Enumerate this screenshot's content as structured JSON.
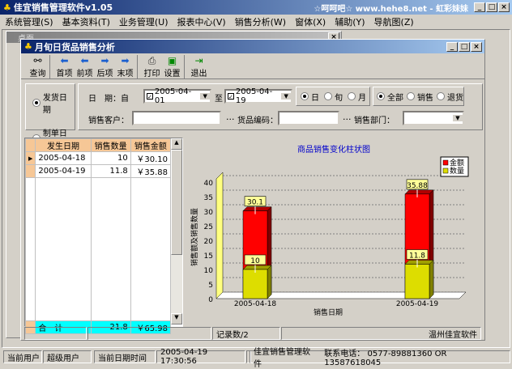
{
  "app": {
    "title": "佳宜销售管理软件v1.05",
    "right_title": "☆呵呵吧☆ www.hehe8.net - 虹彩妹妹"
  },
  "menu": [
    "系统管理(S)",
    "基本资料(T)",
    "业务管理(U)",
    "报表中心(V)",
    "销售分析(W)",
    "窗体(X)",
    "辅助(Y)",
    "导航图(Z)"
  ],
  "desktop_window": {
    "title": "桌面"
  },
  "window": {
    "title": "月旬日货品销售分析"
  },
  "toolbar": [
    {
      "label": "查询",
      "icon": "binoculars-icon"
    },
    {
      "label": "首项",
      "icon": "arrow-left-icon"
    },
    {
      "label": "前项",
      "icon": "arrow-left-icon"
    },
    {
      "label": "后项",
      "icon": "arrow-right-icon"
    },
    {
      "label": "末项",
      "icon": "arrow-right-icon"
    },
    {
      "label": "打印",
      "icon": "printer-icon"
    },
    {
      "label": "设置",
      "icon": "monitor-icon"
    },
    {
      "label": "退出",
      "icon": "exit-icon"
    }
  ],
  "filters": {
    "date_type": [
      "发货日期",
      "制单日期"
    ],
    "date_label": "日　期：自",
    "from": "2005-04-01",
    "to_label": "至",
    "to": "2005-04-19",
    "period": [
      "日",
      "旬",
      "月"
    ],
    "kind": [
      "全部",
      "销售",
      "退货"
    ],
    "customer_label": "销售客户：",
    "customer": "",
    "goods_label": "货品编码：",
    "goods": "",
    "dept_label": "销售部门：",
    "dept": "",
    "ellipsis": "..."
  },
  "grid": {
    "headers": [
      "发生日期",
      "销售数量",
      "销售金额"
    ],
    "rows": [
      [
        "2005-04-18",
        "10",
        "￥30.10"
      ],
      [
        "2005-04-19",
        "11.8",
        "￥35.88"
      ]
    ],
    "total": [
      "合　计",
      "21.8",
      "￥65.98"
    ]
  },
  "chart_data": {
    "type": "bar",
    "title": "商品销售变化柱状图",
    "categories": [
      "2005-04-18",
      "2005-04-19"
    ],
    "series": [
      {
        "name": "金额",
        "values": [
          30.1,
          35.88
        ],
        "color": "#ff0000"
      },
      {
        "name": "数量",
        "values": [
          10,
          11.8
        ],
        "color": "#dddd00"
      }
    ],
    "xlabel": "销售日期",
    "ylabel": "销售额及销售数量",
    "ylim": [
      0,
      40
    ],
    "yticks": [
      "0",
      "5",
      "10",
      "15",
      "20",
      "25",
      "30",
      "35",
      "40"
    ],
    "legend": "top-right",
    "grid": true
  },
  "inner_status": {
    "records": "记录数/2",
    "company": "温州佳宜软件"
  },
  "status": {
    "user_label": "当前用户",
    "user": "超级用户",
    "time_label": "当前日期时间",
    "time": "2005-04-19 17:30:56",
    "product": "佳宜销售管理软件",
    "contact": "联系电话： 0577-89881360 OR 13587618045"
  }
}
